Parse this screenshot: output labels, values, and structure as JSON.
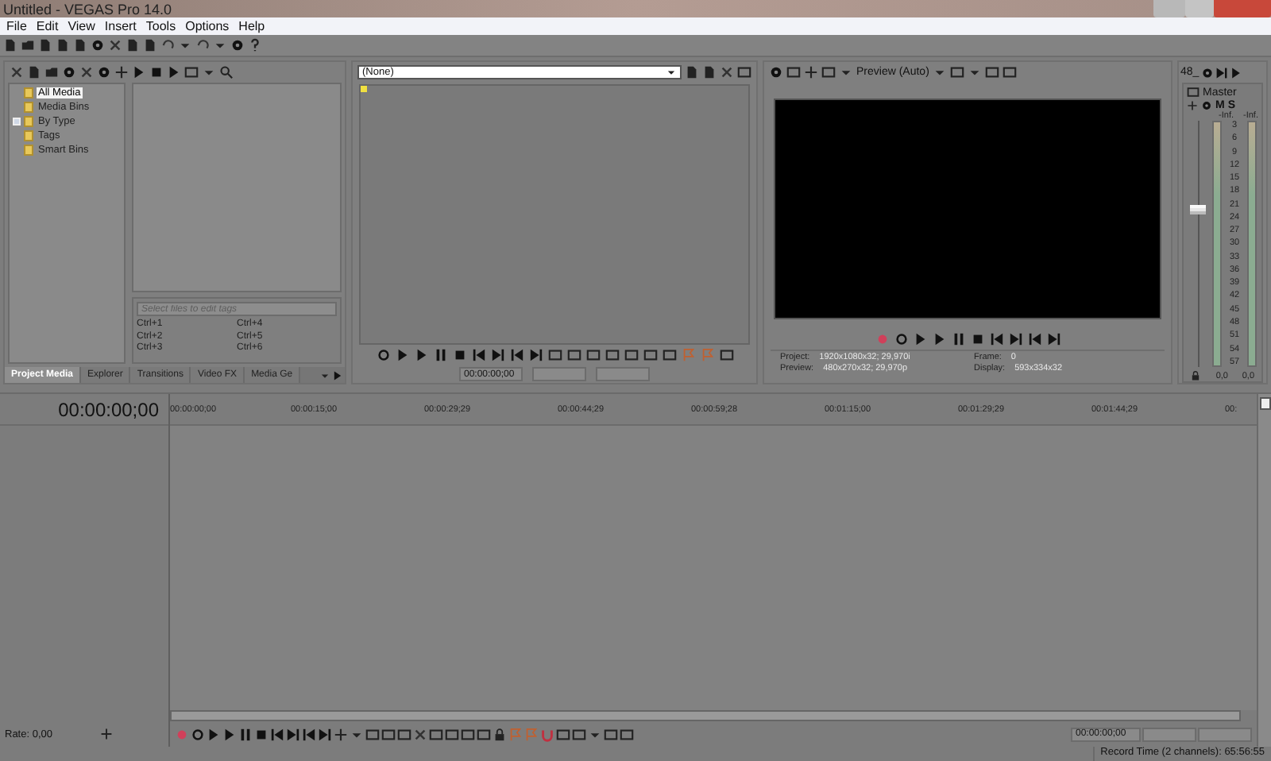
{
  "window": {
    "title": "Untitled - VEGAS Pro 14.0"
  },
  "menu": [
    "File",
    "Edit",
    "View",
    "Insert",
    "Tools",
    "Options",
    "Help"
  ],
  "media_tree": [
    {
      "label": "All Media",
      "selected": true,
      "has_children": false
    },
    {
      "label": "Media Bins",
      "selected": false,
      "has_children": false
    },
    {
      "label": "By Type",
      "selected": false,
      "has_children": true
    },
    {
      "label": "Tags",
      "selected": false,
      "has_children": false
    },
    {
      "label": "Smart Bins",
      "selected": false,
      "has_children": false
    }
  ],
  "tags": {
    "placeholder": "Select files to edit tags",
    "shortcuts": [
      "Ctrl+1",
      "Ctrl+4",
      "Ctrl+2",
      "Ctrl+5",
      "Ctrl+3",
      "Ctrl+6"
    ]
  },
  "dock_tabs": [
    {
      "label": "Project Media",
      "selected": true
    },
    {
      "label": "Explorer",
      "selected": false
    },
    {
      "label": "Transitions",
      "selected": false
    },
    {
      "label": "Video FX",
      "selected": false
    },
    {
      "label": "Media Ge",
      "selected": false
    }
  ],
  "trimmer": {
    "source": "(None)",
    "time": "00:00:00;00"
  },
  "preview": {
    "quality": "Preview (Auto)",
    "info": [
      {
        "label": "Project:",
        "value": "1920x1080x32; 29,970i"
      },
      {
        "label": "Frame:",
        "value": "0"
      },
      {
        "label": "Preview:",
        "value": "480x270x32; 29,970p"
      },
      {
        "label": "Display:",
        "value": "593x334x32"
      }
    ]
  },
  "mixer": {
    "sample_rate": "48_",
    "bus": "Master",
    "mute": "M",
    "solo": "S",
    "peaks": [
      "-Inf.",
      "-Inf."
    ],
    "scale": [
      "3",
      "6",
      "9",
      "12",
      "15",
      "18",
      "21",
      "24",
      "27",
      "30",
      "33",
      "36",
      "39",
      "42",
      "45",
      "48",
      "51",
      "54",
      "57"
    ],
    "readings": [
      "0,0",
      "0,0"
    ],
    "fader": {
      "level": 0.62
    }
  },
  "timeline": {
    "time": "00:00:00;00",
    "ruler": [
      "00:00:00;00",
      "00:00:15;00",
      "00:00:29;29",
      "00:00:44;29",
      "00:00:59;28",
      "00:01:15;00",
      "00:01:29;29",
      "00:01:44;29",
      "00:"
    ],
    "rate": "Rate: 0,00",
    "time_field": "00:00:00;00"
  },
  "status_bar": {
    "record_time": "Record Time (2 channels): 65:56:55"
  }
}
